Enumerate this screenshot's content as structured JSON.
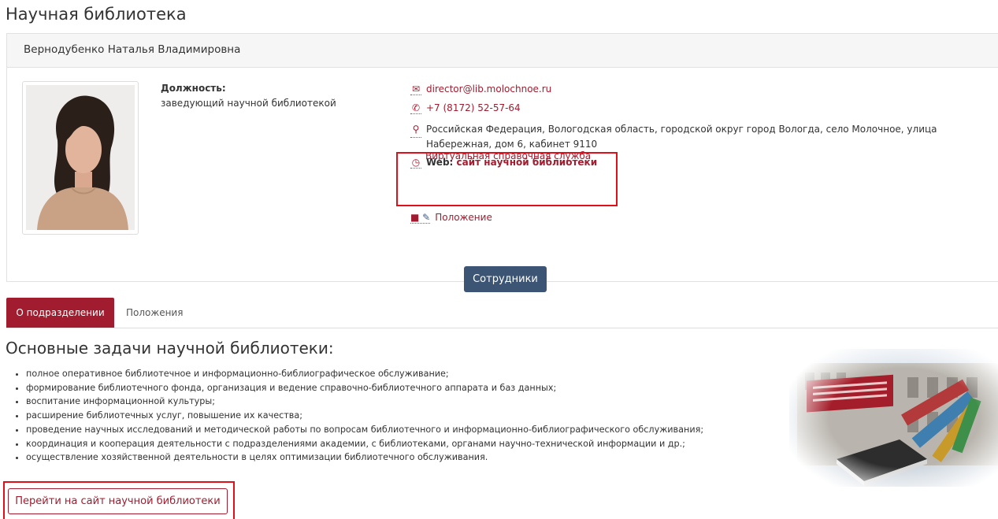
{
  "page": {
    "title": "Научная библиотека"
  },
  "person": {
    "name": "Вернодубенко Наталья Владимировна",
    "position_label": "Должность:",
    "position_value": "заведующий научной библиотекой"
  },
  "contacts": {
    "email": "director@lib.molochnoe.ru",
    "phone": "+7 (8172) 52-57-64",
    "address": "Российская Федерация, Вологодская область, городской округ город Вологда, село Молочное, улица Набережная, дом 6, кабинет 9110",
    "web_label": "Web:",
    "web_link": "сайт научной библиотеки",
    "virtual_service": "Виртуальная справочная служба",
    "document": "Положение"
  },
  "staff_button": "Сотрудники",
  "tabs": [
    {
      "label": "О подразделении",
      "active": true
    },
    {
      "label": "Положения",
      "active": false
    }
  ],
  "section": {
    "title": "Основные задачи научной библиотеки:",
    "tasks": [
      "полное оперативное библиотечное и информационно-библиографическое обслуживание;",
      "формирование библиотечного фонда, организация и ведение справочно-библиотечного аппарата и баз данных;",
      "воспитание информационной культуры;",
      "расширение библиотечных услуг, повышение их качества;",
      "проведение научных исследований и методической работы по вопросам библиотечного и информационно-библиографического обслуживания;",
      "координация и кооперация деятельности с подразделениями академии, с библиотеками, органами научно-технической информации и др.;",
      "осуществление хозяйственной деятельности в целях оптимизации библиотечного обслуживания."
    ]
  },
  "goto_button": "Перейти на сайт научной библиотеки",
  "colors": {
    "accent": "#a11c2e",
    "staff_button": "#3d5574",
    "highlight": "#e0101a"
  }
}
